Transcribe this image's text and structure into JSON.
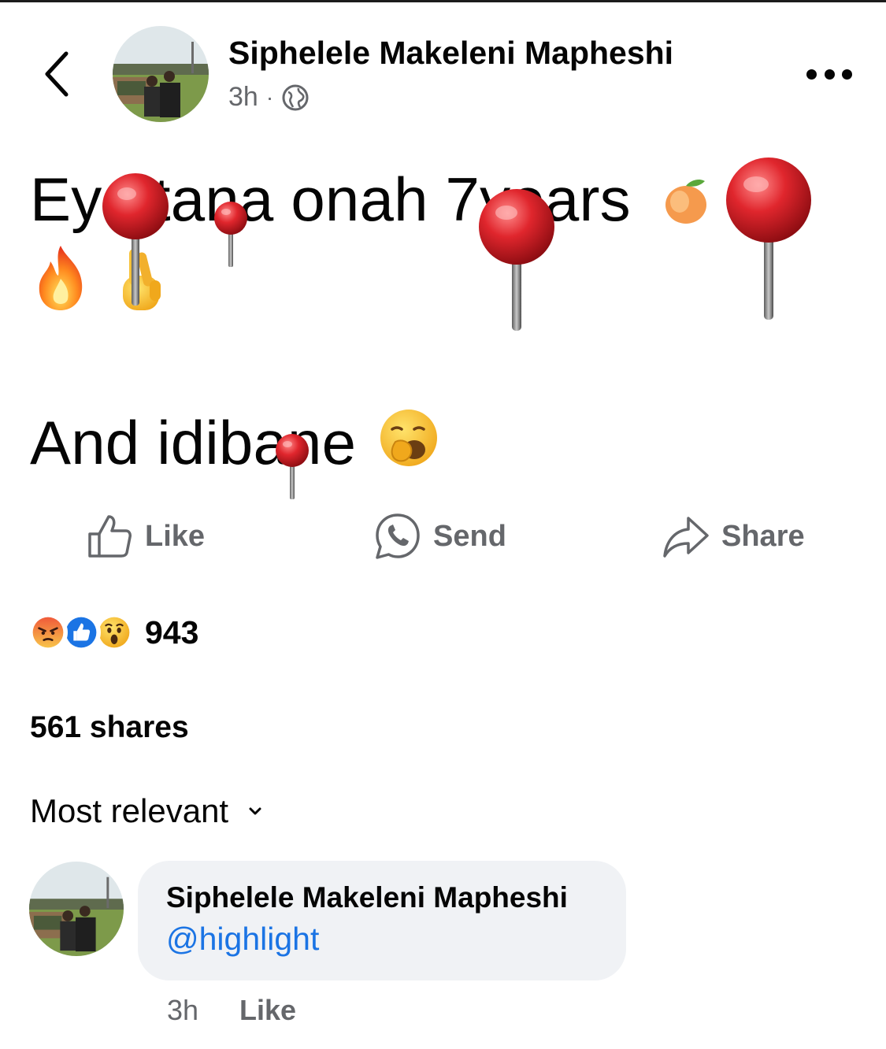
{
  "post": {
    "author": "Siphelele Makeleni Mapheshi",
    "time": "3h",
    "separator": "·",
    "privacy_icon": "globe-icon",
    "line1": "Ey ntana onah 7years",
    "line2": "And idibane",
    "emojis_line1": [
      "peach-emoji",
      "fire-emoji",
      "crossed-fingers-emoji"
    ],
    "emoji_line2": "yawning-face-emoji"
  },
  "actions": {
    "like": "Like",
    "send": "Send",
    "share": "Share"
  },
  "stats": {
    "reaction_icons": [
      "angry-icon",
      "like-icon",
      "wow-icon"
    ],
    "reaction_count": "943",
    "shares": "561 shares"
  },
  "sort": {
    "label": "Most relevant"
  },
  "comment": {
    "author": "Siphelele Makeleni Mapheshi",
    "text": "@highlight",
    "time": "3h",
    "like": "Like"
  },
  "colors": {
    "text": "#050505",
    "secondary": "#65676b",
    "link": "#1b74e4",
    "bubble": "#f0f2f5",
    "pin": "#d3252b"
  }
}
